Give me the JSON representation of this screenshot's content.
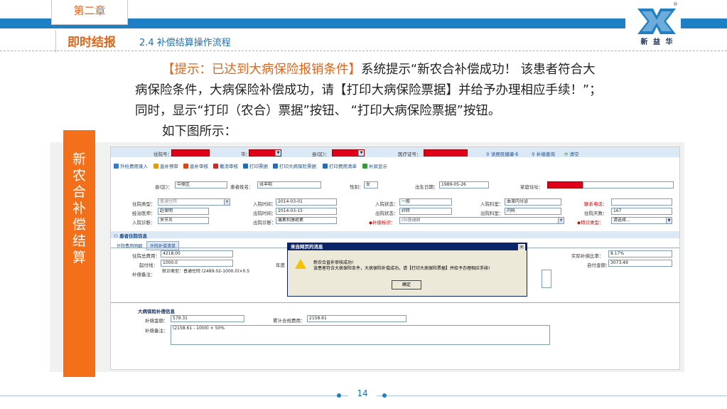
{
  "header": {
    "chapter": "第二章",
    "chapter_subtitle": "即时结报",
    "section_title": "2.4 补偿结算操作流程",
    "logo_text": "新 益 华",
    "logo_mark": "®"
  },
  "description": {
    "highlight": "【提示：已达到大病保险报销条件】",
    "line1_rest": "系统提示“新农合补偿成功！ 该患者符合大",
    "line2": "病保险条件，大病保险补偿成功，请【打印大病保险票据】并给予办理相应手续！”；",
    "line3": "同时，显示“打印（农合）票据”按钮、 “打印大病保险票据”按钮。",
    "line4": "如下图所示："
  },
  "sidebar": {
    "text": "新农合补偿结算"
  },
  "screenshot": {
    "top_fields": {
      "hospital_no_label": "住院号：",
      "city_label": "市：",
      "county_label": "县(区)：",
      "medical_card_label": "医疗证号：",
      "read_card": "读居民健康卡",
      "query_comp": "补偿查询",
      "clear": "清空"
    },
    "toolbar": [
      "外检费用录入",
      "直补预审",
      "直补审核",
      "撤消审核",
      "打印票据",
      "打印大病保险票据",
      "打印费用清单",
      "补屏显示"
    ],
    "patient": {
      "county_label": "县(区)：",
      "county_value": "中原区",
      "name_label": "患者姓名：",
      "name_value": "张丰昭",
      "gender_label": "性别：",
      "gender_value": "女",
      "birth_label": "出生日期：",
      "birth_value": "1989-05-26",
      "address_label": "家庭住址："
    },
    "admission": {
      "type_label": "住院类型：",
      "type_value": "普通住院",
      "doctor_label": "经治医师：",
      "doctor_value": "赵保明",
      "in_diag_label": "入院诊断：",
      "in_diag_value": "关节炎",
      "in_time_label": "入院时间：",
      "in_time_value": "2014-03-01",
      "out_time_label": "出院时间：",
      "out_time_value": "2014-03-15",
      "out_diag_label": "出院诊断：",
      "out_diag_value": "痛紊和激绝紊",
      "in_state_label": "入院状态：",
      "in_state_value": "一般",
      "out_state_label": "出院状态：",
      "out_state_value": "好转",
      "comp_flag_label": "◆补偿标识：",
      "comp_flag_value": "(0)普通病",
      "in_dept_label": "入院科室：",
      "in_dept_value": "血液内分泌",
      "out_dept_label": "出院科室：",
      "out_dept_value": "内科",
      "phone_label": "联系电话：",
      "days_label": "住院天数：",
      "days_value": "167",
      "special_label": "◆特诊类型：",
      "special_value": "请选择..."
    },
    "section_info": "患者住院信息",
    "tabs": [
      "住院费用明细",
      "住院补偿清单"
    ],
    "payment": {
      "total_label": "住院总费用：",
      "total_value": "4218.00",
      "start_label": "起付线：",
      "start_value": "1000.0",
      "year_label": "年度",
      "note_label": "补偿备注：",
      "note_value": "就诊类型：普通住院 (2489.02-1000.0)×0.5",
      "ratio_label": "实际补偿比率：",
      "ratio_value": "8.17%",
      "self_label": "自付金额：",
      "self_value": "3073.49"
    },
    "serious": {
      "title": "大病保险补偿信息",
      "amount_label": "补偿金额：",
      "amount_value": "579.31",
      "cum_label": "累计合规费用：",
      "cum_value": "2158.61",
      "note_label": "补偿备注：",
      "note_value": "(2158.61 - 1000) × 50%"
    },
    "dialog": {
      "title": "来自网页的消息",
      "line1": "新农合直补审核成功!",
      "line2": "该患者符合大病保险条件，大病保险补偿成功，请【打印大病保险票据】并给予办理相应手续!",
      "ok": "确定",
      "close": "×"
    }
  },
  "footer": {
    "page": "14"
  },
  "colors": {
    "accent_orange": "#f36f1a",
    "header_blue": "#1f7fc4",
    "text_orange": "#e0661b"
  }
}
